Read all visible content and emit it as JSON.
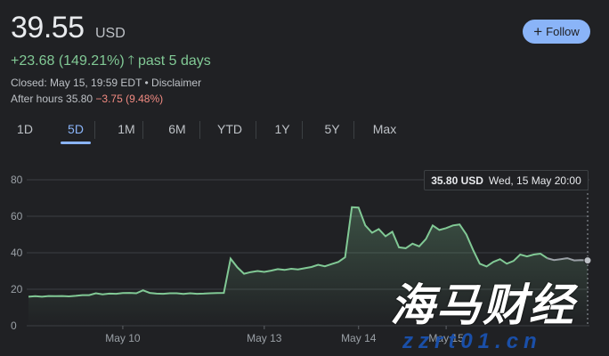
{
  "header": {
    "price": "39.55",
    "currency": "USD",
    "change": "+23.68 (149.21%)",
    "change_arrow": "arrow-up-icon",
    "change_period": "past 5 days",
    "closed_text": "Closed: May 15, 19:59 EDT • Disclaimer",
    "after_hours_label": "After hours 35.80",
    "after_hours_change": "−3.75 (9.48%)"
  },
  "follow": {
    "icon": "plus-icon",
    "label": "Follow"
  },
  "tabs": [
    {
      "label": "1D",
      "active": false
    },
    {
      "label": "5D",
      "active": true
    },
    {
      "label": "1M",
      "active": false
    },
    {
      "label": "6M",
      "active": false
    },
    {
      "label": "YTD",
      "active": false
    },
    {
      "label": "1Y",
      "active": false
    },
    {
      "label": "5Y",
      "active": false
    },
    {
      "label": "Max",
      "active": false
    }
  ],
  "tooltip": {
    "price": "35.80 USD",
    "date": "Wed, 15 May 20:00"
  },
  "watermark": {
    "text": "海马财经",
    "url": "zzrt01.cn"
  },
  "colors": {
    "background": "#202124",
    "line": "#81c995",
    "accent": "#8ab4f8",
    "negative": "#f28b82"
  },
  "chart_data": {
    "type": "area",
    "x_tick_labels": [
      "May 10",
      "May 13",
      "May 14",
      "May 15"
    ],
    "y_ticks": [
      0,
      20,
      40,
      60,
      80
    ],
    "ylim": [
      0,
      80
    ],
    "grid": "horizontal",
    "series": [
      {
        "color": "#81c995",
        "values": [
          15.9,
          16.2,
          15.9,
          16.3,
          16.2,
          16.3,
          16.1,
          16.4,
          16.8,
          16.8,
          17.8,
          17.2,
          17.6,
          17.5,
          17.9,
          18.0,
          17.8,
          19.4,
          18.0,
          17.6,
          17.5,
          17.8,
          17.8,
          17.4,
          17.8,
          17.5,
          17.6,
          17.8,
          17.9,
          18.0,
          36.8,
          32.0,
          28.5,
          29.4,
          30.0,
          29.5,
          30.2,
          31.0,
          30.6,
          31.2,
          30.9,
          31.5,
          32.2,
          33.4,
          32.6,
          33.8,
          35.0,
          37.5,
          65.0,
          64.8,
          55.0,
          51.0,
          53.0,
          49.0,
          51.5,
          43.0,
          42.5,
          45.0,
          43.5,
          47.5,
          55.0,
          52.5,
          53.5,
          55.0,
          55.5,
          50.0,
          41.5,
          34.0,
          32.5,
          35.0,
          36.5,
          34.0,
          35.5,
          39.0,
          38.0,
          39.0,
          39.5,
          37.0,
          36.0,
          36.5,
          37.0,
          35.8,
          36.0,
          35.8
        ]
      }
    ],
    "x_tick_positions": [
      14,
      35,
      49,
      62
    ],
    "last_point_label": "35.80"
  }
}
